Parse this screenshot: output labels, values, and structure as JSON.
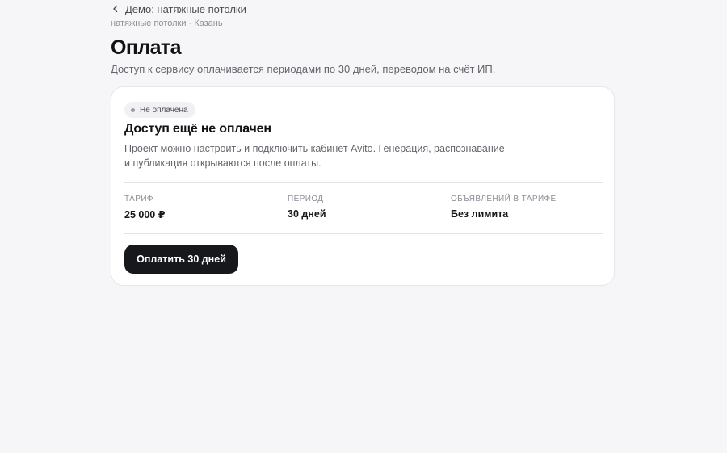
{
  "nav": {
    "back_label": "Демо: натяжные потолки",
    "breadcrumb": "натяжные потолки · Казань"
  },
  "header": {
    "title": "Оплата",
    "subtitle": "Доступ к сервису оплачивается периодами по 30 дней, переводом на счёт ИП."
  },
  "card": {
    "badge": "Не оплачена",
    "title": "Доступ ещё не оплачен",
    "description_line1": "Проект можно настроить и подключить кабинет Avito. Генерация, распознавание",
    "description_line2": "и публикация открываются после оплаты.",
    "stats": [
      {
        "label": "ТАРИФ",
        "value": "25 000 ₽"
      },
      {
        "label": "ПЕРИОД",
        "value": "30 дней"
      },
      {
        "label": "ОБЪЯВЛЕНИЙ В ТАРИФЕ",
        "value": "Без лимита"
      }
    ],
    "pay_button": "Оплатить 30 дней"
  },
  "icons": {
    "back": "chevron-left-icon",
    "badge_dot": "status-dot-icon"
  },
  "colors": {
    "background": "#f6f6f8",
    "card": "#ffffff",
    "primary_button": "#17181c",
    "muted_text": "#62656c"
  }
}
